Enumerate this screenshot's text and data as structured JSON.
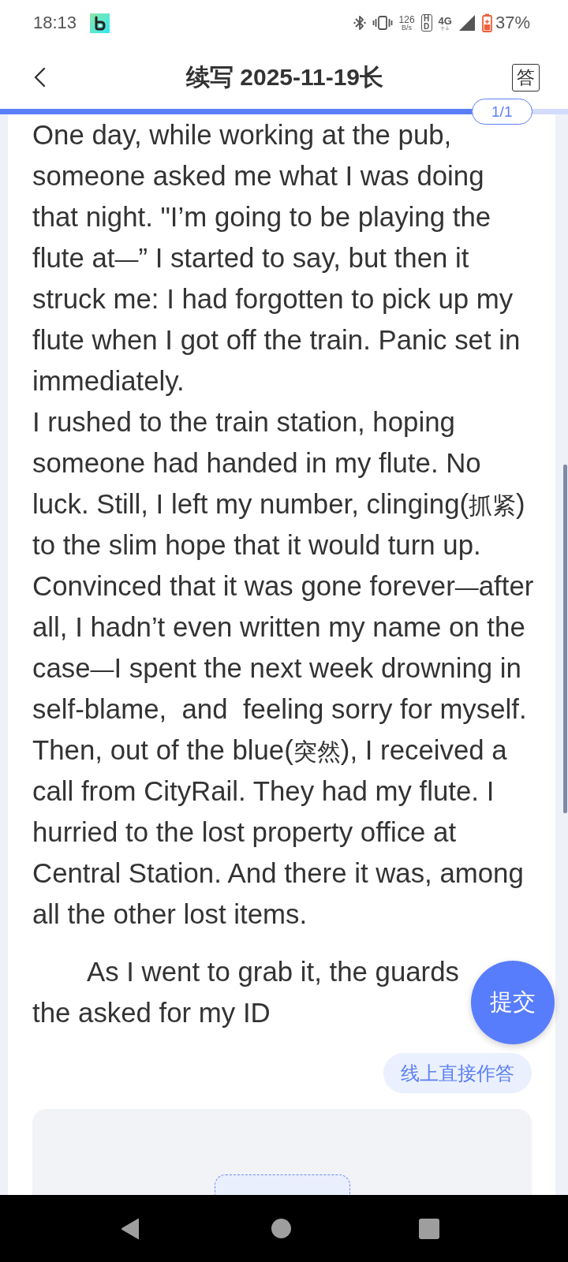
{
  "status_bar": {
    "time": "18:13",
    "net_speed_value": "126",
    "net_speed_unit": "B/s",
    "hd": "HD",
    "network": "4G",
    "battery": "37%"
  },
  "header": {
    "title": "续写 2025-11-19长",
    "answer_button": "答"
  },
  "progress": {
    "level": 0.833,
    "label": "1/1"
  },
  "passage": [
    {
      "text": "One day, while working at the pub, someone asked me what I was doing that night. \"I’m going to be playing the flute at—” I started to say, but then it struck me: I had forgotten to pick up my flute when I got off the train. Panic set in immediately.",
      "indent": false
    },
    {
      "text": "I rushed to the train station, hoping someone had handed in my flute. No luck. Still, I left my number, clinging(抓紧) to the slim hope that it would turn up. Convinced that it was gone forever—after all, I hadn’t even written my name on the case—I spent the next week drowning in self-blame,  and  feeling sorry for myself. Then, out of the blue(突然), I received a call from CityRail. They had my flute. I hurried to the lost property office at Central Station. And there it was, among all the other lost items.",
      "indent": false
    },
    {
      "text": "As I went to grab it, the guards the asked for my ID",
      "indent": true
    }
  ],
  "submit_button": "提交",
  "online_answer_button": "线上直接作答"
}
